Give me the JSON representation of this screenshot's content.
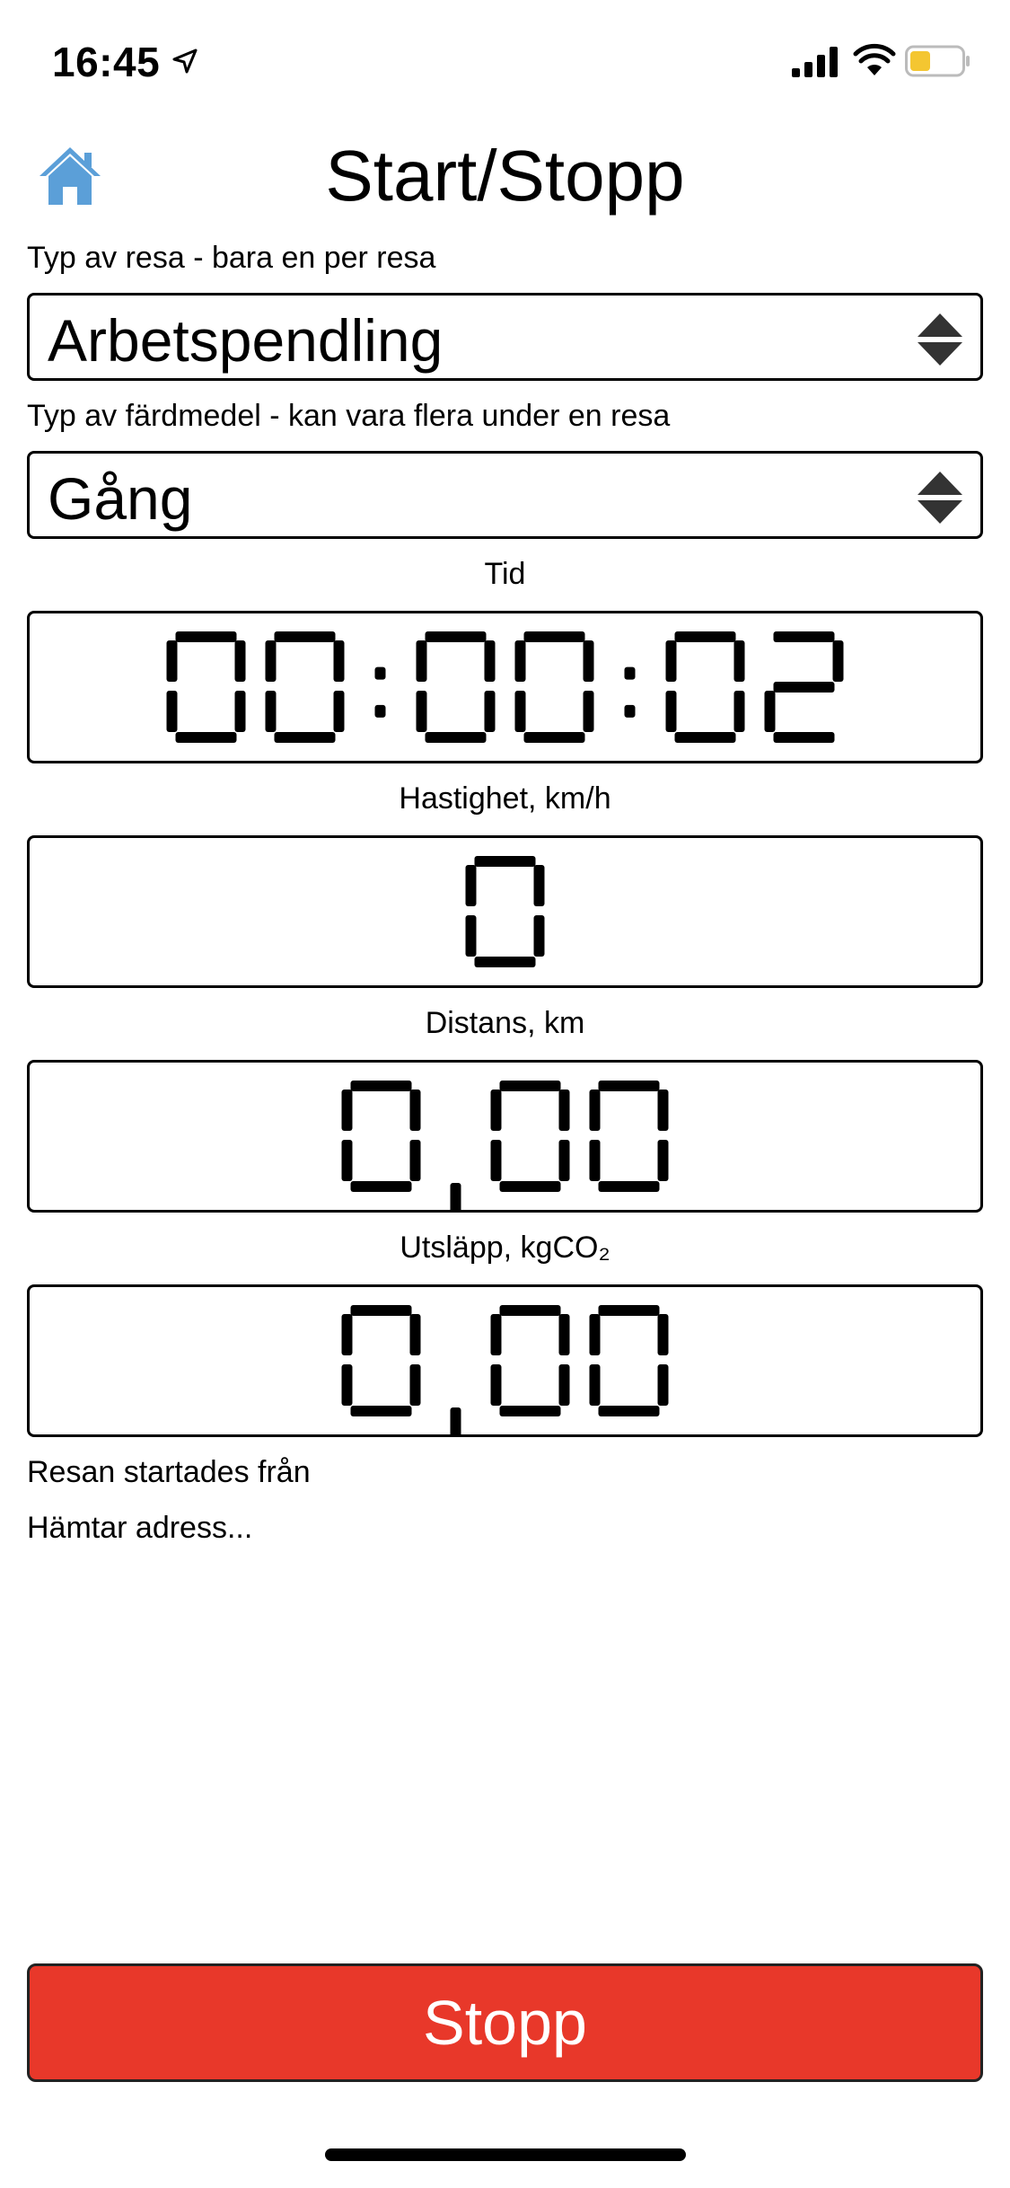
{
  "status_bar": {
    "time": "16:45",
    "battery_color": "#f4c631"
  },
  "header": {
    "title": "Start/Stopp",
    "home_icon": "home-icon",
    "home_icon_color": "#5b9fd8"
  },
  "trip_type": {
    "label": "Typ av resa - bara en per resa",
    "selected": "Arbetspendling"
  },
  "transport_mode": {
    "label": "Typ av färdmedel - kan vara flera under en resa",
    "selected": "Gång"
  },
  "time": {
    "label": "Tid",
    "value": "00:00:02"
  },
  "speed": {
    "label": "Hastighet, km/h",
    "value": "0"
  },
  "distance": {
    "label": "Distans, km",
    "value": "0,00"
  },
  "emissions": {
    "label": "Utsläpp, kgCO₂",
    "value": "0,00"
  },
  "trip_start": {
    "label": "Resan startades från",
    "address": "Hämtar adress..."
  },
  "actions": {
    "stop_label": "Stopp",
    "stop_color": "#e8382a"
  }
}
